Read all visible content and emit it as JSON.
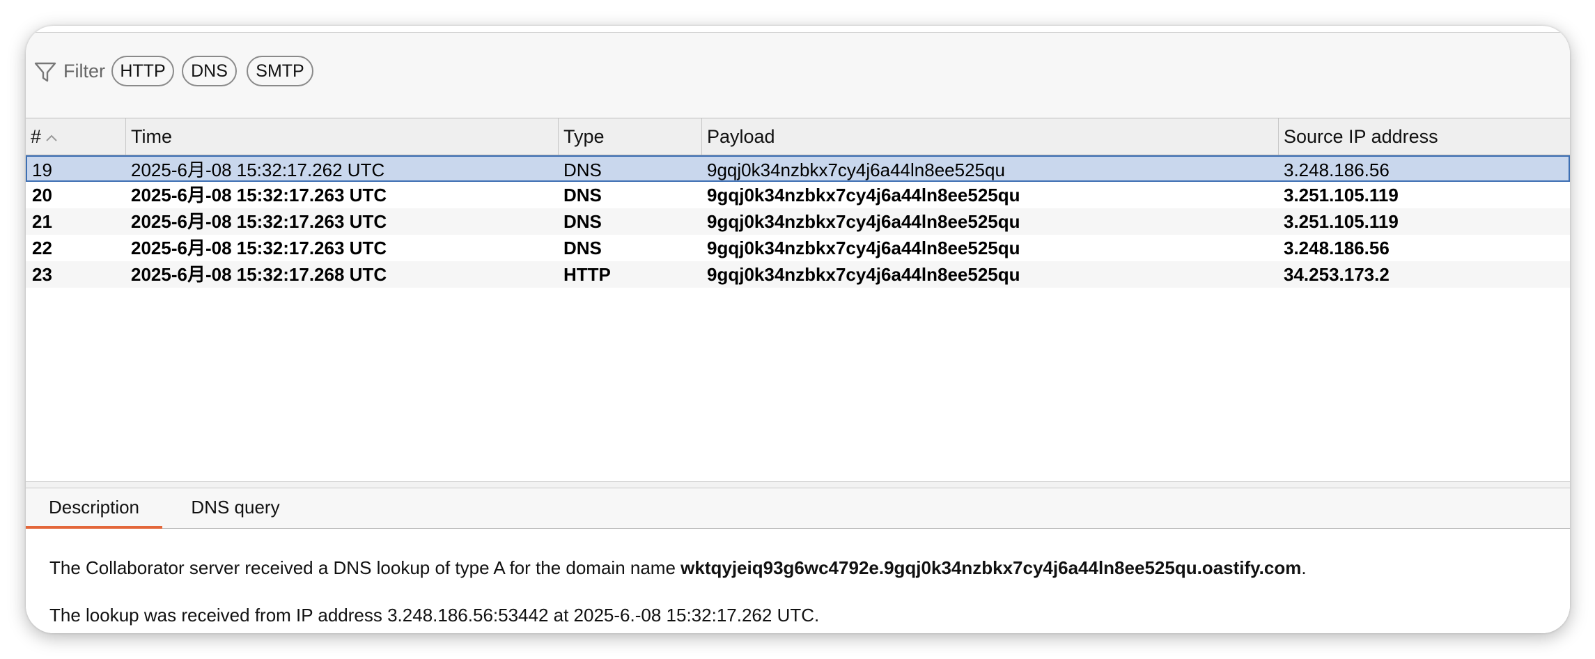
{
  "filter": {
    "label": "Filter",
    "chips": [
      "HTTP",
      "DNS",
      "SMTP"
    ]
  },
  "table": {
    "columns": [
      "#",
      "Time",
      "Type",
      "Payload",
      "Source IP address"
    ],
    "rows": [
      {
        "num": "19",
        "time": "2025-6月-08 15:32:17.262 UTC",
        "type": "DNS",
        "payload": "9gqj0k34nzbkx7cy4j6a44ln8ee525qu",
        "source_ip": "3.248.186.56",
        "selected": true,
        "bold": false
      },
      {
        "num": "20",
        "time": "2025-6月-08 15:32:17.263 UTC",
        "type": "DNS",
        "payload": "9gqj0k34nzbkx7cy4j6a44ln8ee525qu",
        "source_ip": "3.251.105.119",
        "selected": false,
        "bold": true
      },
      {
        "num": "21",
        "time": "2025-6月-08 15:32:17.263 UTC",
        "type": "DNS",
        "payload": "9gqj0k34nzbkx7cy4j6a44ln8ee525qu",
        "source_ip": "3.251.105.119",
        "selected": false,
        "bold": true
      },
      {
        "num": "22",
        "time": "2025-6月-08 15:32:17.263 UTC",
        "type": "DNS",
        "payload": "9gqj0k34nzbkx7cy4j6a44ln8ee525qu",
        "source_ip": "3.248.186.56",
        "selected": false,
        "bold": true
      },
      {
        "num": "23",
        "time": "2025-6月-08 15:32:17.268 UTC",
        "type": "HTTP",
        "payload": "9gqj0k34nzbkx7cy4j6a44ln8ee525qu",
        "source_ip": "34.253.173.2",
        "selected": false,
        "bold": true
      }
    ]
  },
  "tabs": [
    {
      "label": "Description",
      "active": true
    },
    {
      "label": "DNS query",
      "active": false
    }
  ],
  "description": {
    "line1_prefix": "The Collaborator server received a DNS lookup of type A for the domain name ",
    "line1_domain": "wktqyjeiq93g6wc4792e.9gqj0k34nzbkx7cy4j6a44ln8ee525qu.oastify.com",
    "line1_suffix": ".",
    "line2": "The lookup was received from IP address 3.248.186.56:53442 at 2025-6.-08 15:32:17.262 UTC."
  },
  "colors": {
    "selected_row_bg": "#c9d7ed",
    "selected_row_border": "#3d6fb3",
    "active_tab_underline": "#e3673a"
  }
}
